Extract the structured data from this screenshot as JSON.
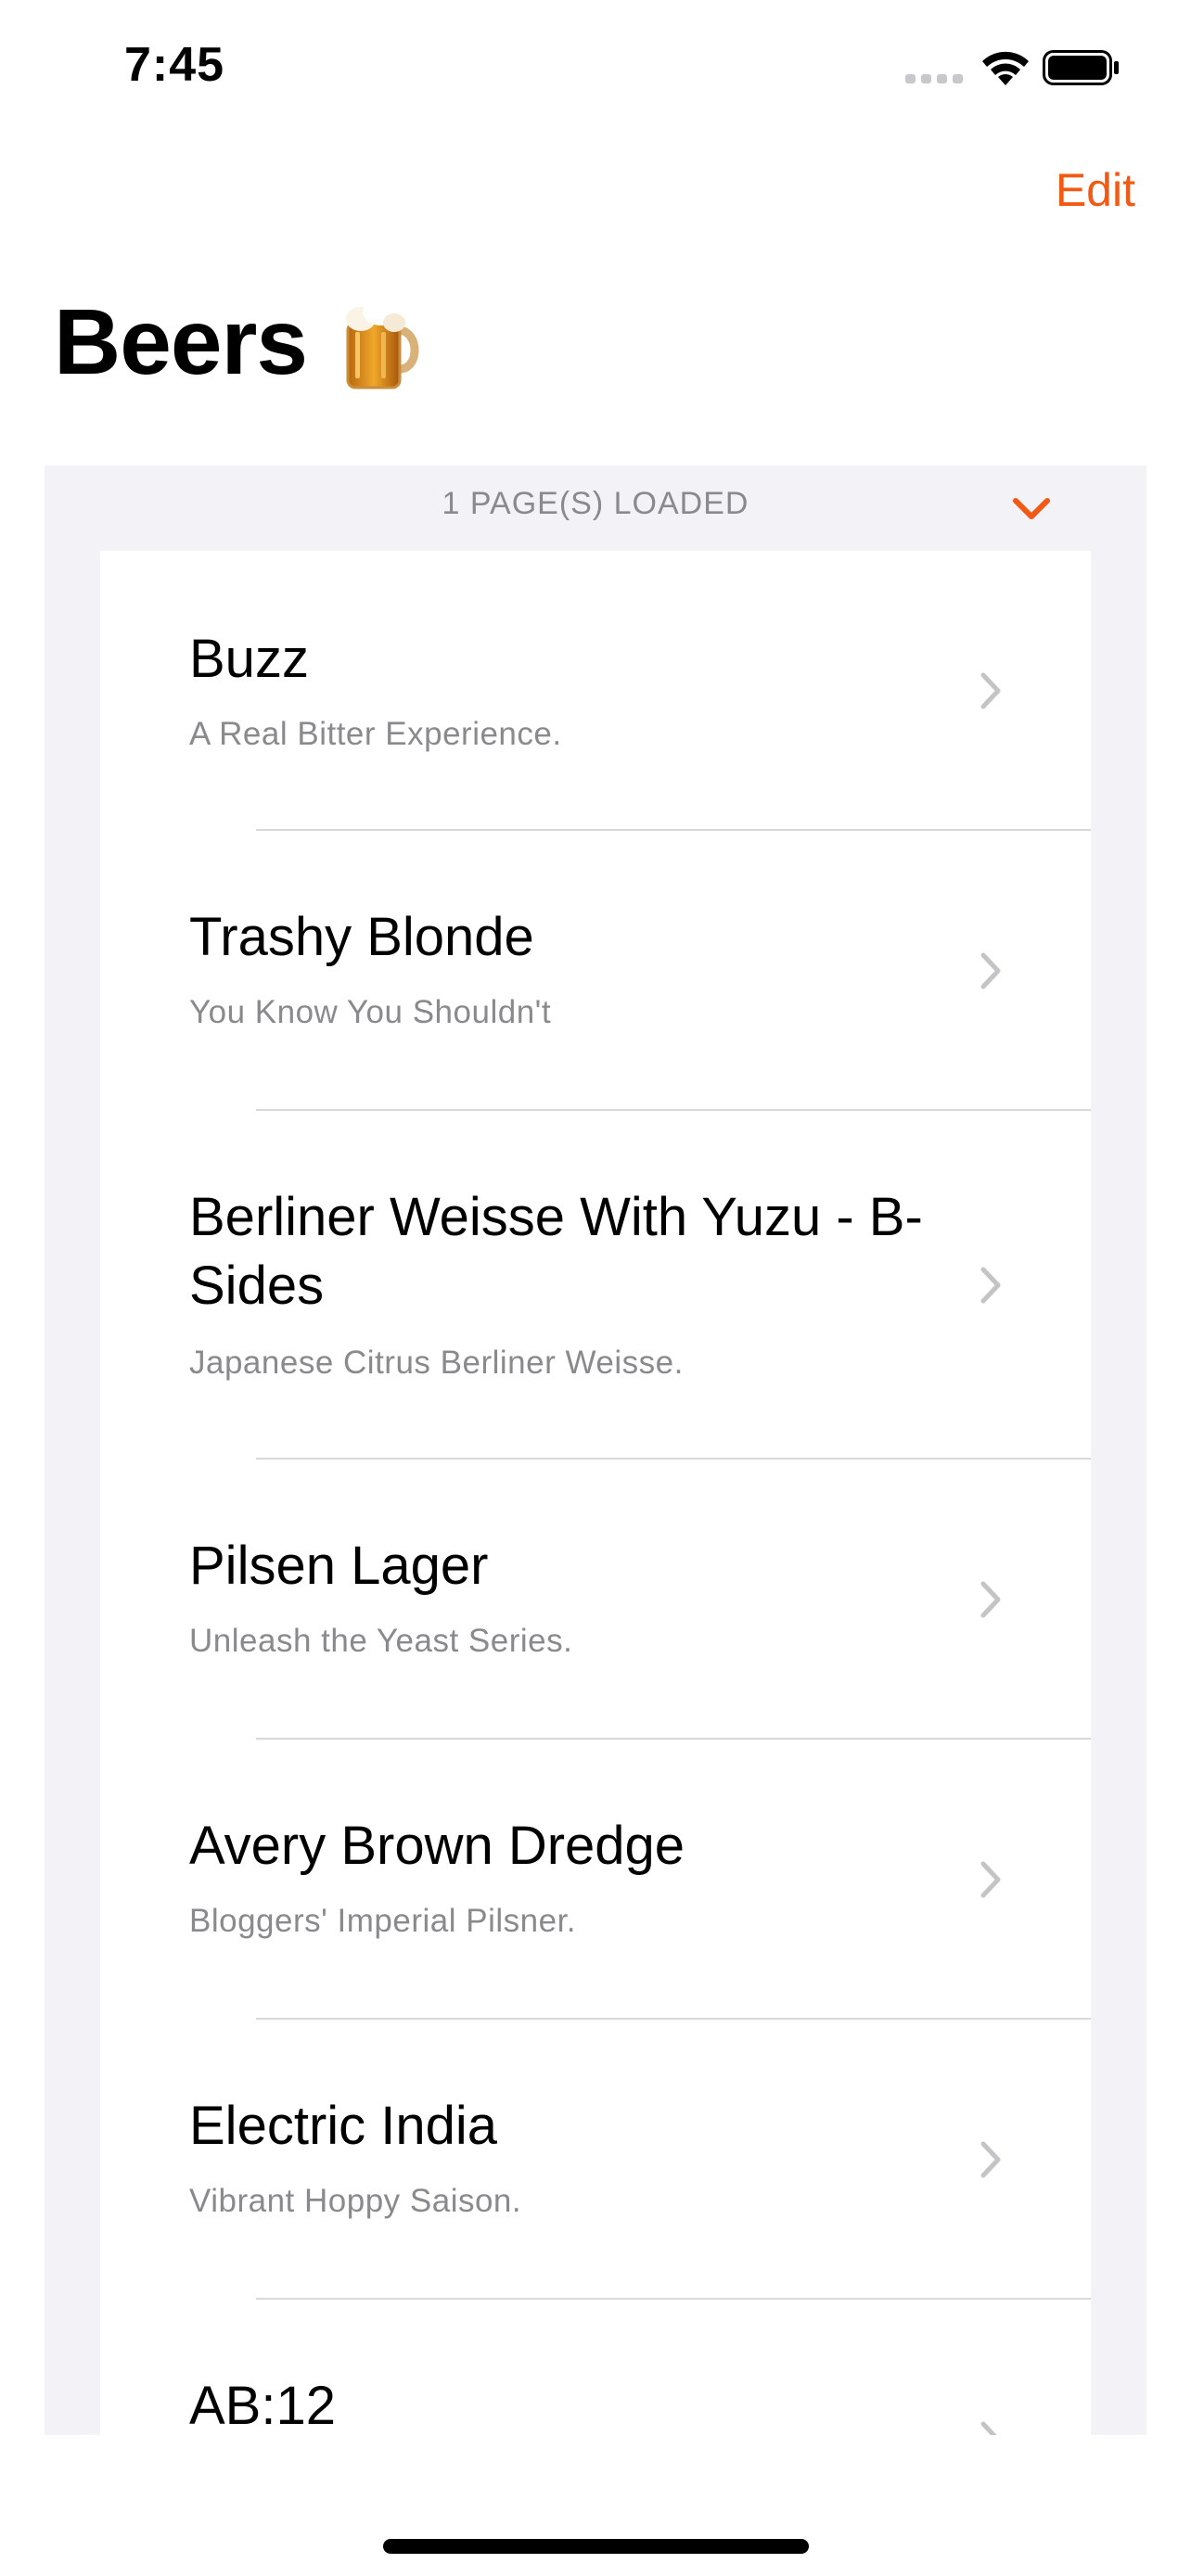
{
  "status_bar": {
    "time": "7:45"
  },
  "nav": {
    "edit_label": "Edit"
  },
  "header": {
    "title": "Beers"
  },
  "list": {
    "section_title": "1 PAGE(S) LOADED",
    "items": [
      {
        "name": "Buzz",
        "tagline": "A Real Bitter Experience."
      },
      {
        "name": "Trashy Blonde",
        "tagline": "You Know You Shouldn't"
      },
      {
        "name": "Berliner Weisse With Yuzu - B-Sides",
        "tagline": "Japanese Citrus Berliner Weisse."
      },
      {
        "name": "Pilsen Lager",
        "tagline": "Unleash the Yeast Series."
      },
      {
        "name": "Avery Brown Dredge",
        "tagline": "Bloggers' Imperial Pilsner."
      },
      {
        "name": "Electric India",
        "tagline": "Vibrant Hoppy Saison."
      },
      {
        "name": "AB:12",
        "tagline": ""
      }
    ]
  },
  "colors": {
    "accent": "#f05a14",
    "grouped_background": "#f2f2f7",
    "secondary_text": "#8a8a8e"
  },
  "icons": {
    "title": "beer-mug-icon",
    "row": "chevron-right-icon",
    "section": "chevron-down-icon"
  }
}
